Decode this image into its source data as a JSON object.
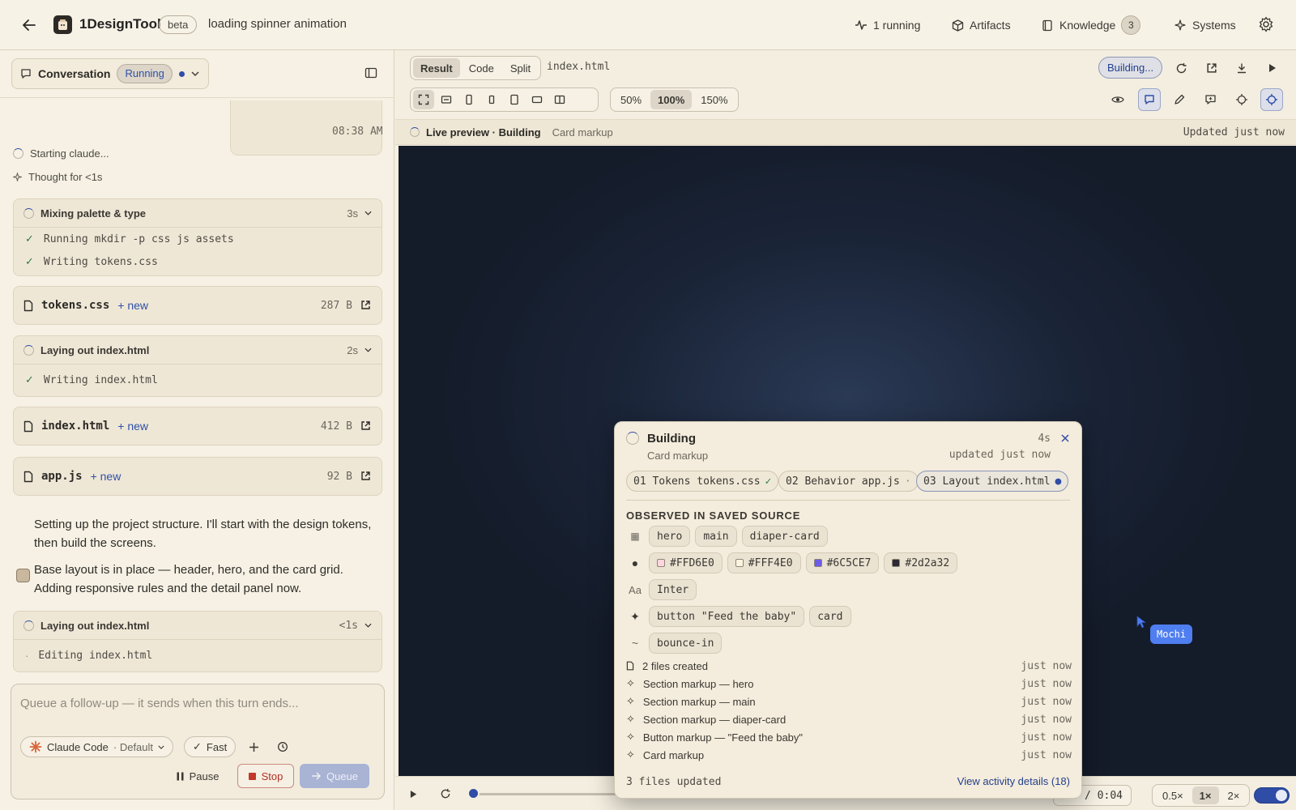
{
  "topbar": {
    "app_name": "1DesignTool",
    "beta_label": "beta",
    "project_title": "loading spinner animation",
    "nav": {
      "running": "1 running",
      "artifacts": "Artifacts",
      "knowledge": "Knowledge",
      "knowledge_count": "3",
      "systems": "Systems"
    }
  },
  "conversation": {
    "label": "Conversation",
    "status": "Running",
    "time": "08:38 AM",
    "starting": "Starting claude...",
    "thought": "Thought for <1s",
    "task1": {
      "title": "Mixing palette & type",
      "duration": "3s",
      "steps": [
        "Running mkdir -p css js assets",
        "Writing tokens.css"
      ]
    },
    "files": [
      {
        "name": "tokens.css",
        "tag": "+ new",
        "size": "287 B"
      },
      {
        "name": "index.html",
        "tag": "+ new",
        "size": "412 B"
      },
      {
        "name": "app.js",
        "tag": "+ new",
        "size": "92 B"
      }
    ],
    "task2": {
      "title": "Laying out index.html",
      "duration": "2s",
      "steps": [
        "Writing index.html"
      ]
    },
    "message": [
      "Setting up the project structure. I'll start with the design tokens, then build the screens.",
      "Base layout is in place — header, hero, and the card grid. Adding responsive rules and the detail panel now."
    ],
    "task3": {
      "title": "Laying out index.html",
      "duration": "<1s",
      "steps": [
        "Editing index.html"
      ]
    }
  },
  "composer": {
    "placeholder": "Queue a follow-up — it sends when this turn ends...",
    "model": "Claude Code",
    "model_mode": "· Default",
    "fast": "Fast",
    "pause": "Pause",
    "stop": "Stop",
    "queue": "Queue"
  },
  "preview_toolbar": {
    "views": [
      "Result",
      "Code",
      "Split"
    ],
    "file": "index.html",
    "building": "Building...",
    "zooms": [
      "50%",
      "100%",
      "150%"
    ]
  },
  "live_bar": {
    "title": "Live preview · Building",
    "subtitle": "Card markup",
    "updated": "Updated just now"
  },
  "popover": {
    "title": "Building",
    "subtitle": "Card markup",
    "duration": "4s",
    "updated": "updated just now",
    "phases": [
      {
        "text": "01 Tokens tokens.css",
        "mark": "✓"
      },
      {
        "text": "02 Behavior app.js",
        "mark": "·"
      },
      {
        "text": "03 Layout index.html",
        "mark": "●"
      }
    ],
    "observed_title": "OBSERVED IN SAVED SOURCE",
    "sections": [
      "hero",
      "main",
      "diaper-card"
    ],
    "colors": [
      {
        "hex": "#FFD6E0",
        "swatch": "#FFD6E0"
      },
      {
        "hex": "#FFF4E0",
        "swatch": "#FFF4E0"
      },
      {
        "hex": "#6C5CE7",
        "swatch": "#6C5CE7"
      },
      {
        "hex": "#2d2a32",
        "swatch": "#2d2a32"
      }
    ],
    "type_label": "Aa",
    "fonts": [
      "Inter"
    ],
    "components": [
      "button \"Feed the baby\"",
      "card"
    ],
    "motion": [
      "bounce-in"
    ],
    "activity": [
      {
        "text": "2 files created",
        "when": "just now"
      },
      {
        "text": "Section markup — hero",
        "when": "just now"
      },
      {
        "text": "Section markup — main",
        "when": "just now"
      },
      {
        "text": "Section markup — diaper-card",
        "when": "just now"
      },
      {
        "text": "Button markup — \"Feed the baby\"",
        "when": "just now"
      },
      {
        "text": "Card markup",
        "when": "just now"
      }
    ],
    "files_updated": "3 files updated",
    "view_details": "View activity details (18)"
  },
  "player": {
    "time": "00 / 0:04",
    "speeds": [
      "0.5×",
      "1×",
      "2×"
    ],
    "progress": 0
  },
  "cursor_label": "Mochi"
}
